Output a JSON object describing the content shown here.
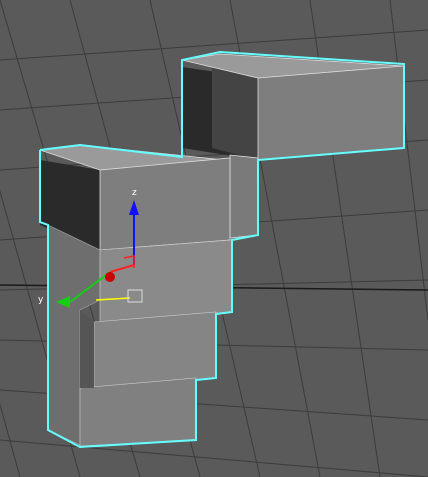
{
  "viewport": {
    "grid_color": "#3a3a3a",
    "background_color": "#5a5a5a",
    "selection_color": "#66ffff"
  },
  "object": {
    "faces": {
      "light": "#9a9a9a",
      "mid": "#7e7e7e",
      "dark": "#2a2a2a",
      "edge_color": "#ffffff"
    }
  },
  "gizmo": {
    "z_label": "z",
    "y_label": "y",
    "z_color": "#1010ff",
    "y_color": "#10d010",
    "x_color": "#ff2020",
    "plane_color": "#ffff00"
  }
}
